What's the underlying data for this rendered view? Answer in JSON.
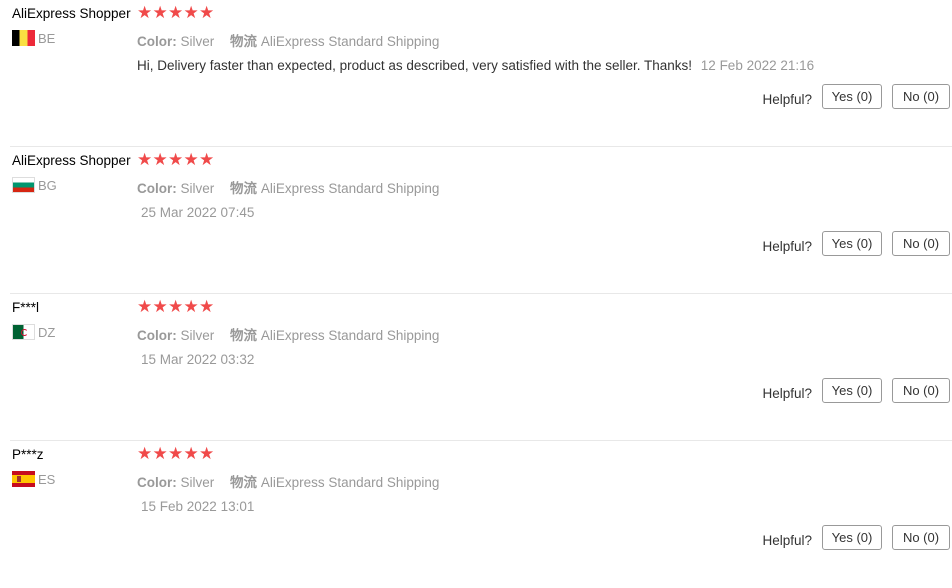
{
  "reviews": [
    {
      "user": "AliExpress Shopper",
      "country": "BE",
      "flag": "flag-be",
      "stars": 5,
      "color_label": "Color:",
      "color_value": "Silver",
      "logistics_label": "物流",
      "logistics_value": "AliExpress Standard Shipping",
      "text": "Hi, Delivery faster than expected, product as described, very satisfied with the seller. Thanks!",
      "date": "12 Feb 2022 21:16",
      "helpful_label": "Helpful?",
      "yes_label": "Yes (0)",
      "no_label": "No (0)"
    },
    {
      "user": "AliExpress Shopper",
      "country": "BG",
      "flag": "flag-bg",
      "stars": 5,
      "color_label": "Color:",
      "color_value": "Silver",
      "logistics_label": "物流",
      "logistics_value": "AliExpress Standard Shipping",
      "text": "",
      "date": "25 Mar 2022 07:45",
      "helpful_label": "Helpful?",
      "yes_label": "Yes (0)",
      "no_label": "No (0)"
    },
    {
      "user": "F***l",
      "country": "DZ",
      "flag": "flag-dz",
      "stars": 5,
      "color_label": "Color:",
      "color_value": "Silver",
      "logistics_label": "物流",
      "logistics_value": "AliExpress Standard Shipping",
      "text": "",
      "date": "15 Mar 2022 03:32",
      "helpful_label": "Helpful?",
      "yes_label": "Yes (0)",
      "no_label": "No (0)"
    },
    {
      "user": "P***z",
      "country": "ES",
      "flag": "flag-es",
      "stars": 5,
      "color_label": "Color:",
      "color_value": "Silver",
      "logistics_label": "物流",
      "logistics_value": "AliExpress Standard Shipping",
      "text": "",
      "date": "15 Feb 2022 13:01",
      "helpful_label": "Helpful?",
      "yes_label": "Yes (0)",
      "no_label": "No (0)"
    }
  ],
  "star_color": "#f04a4a",
  "star_icon": "star-icon"
}
